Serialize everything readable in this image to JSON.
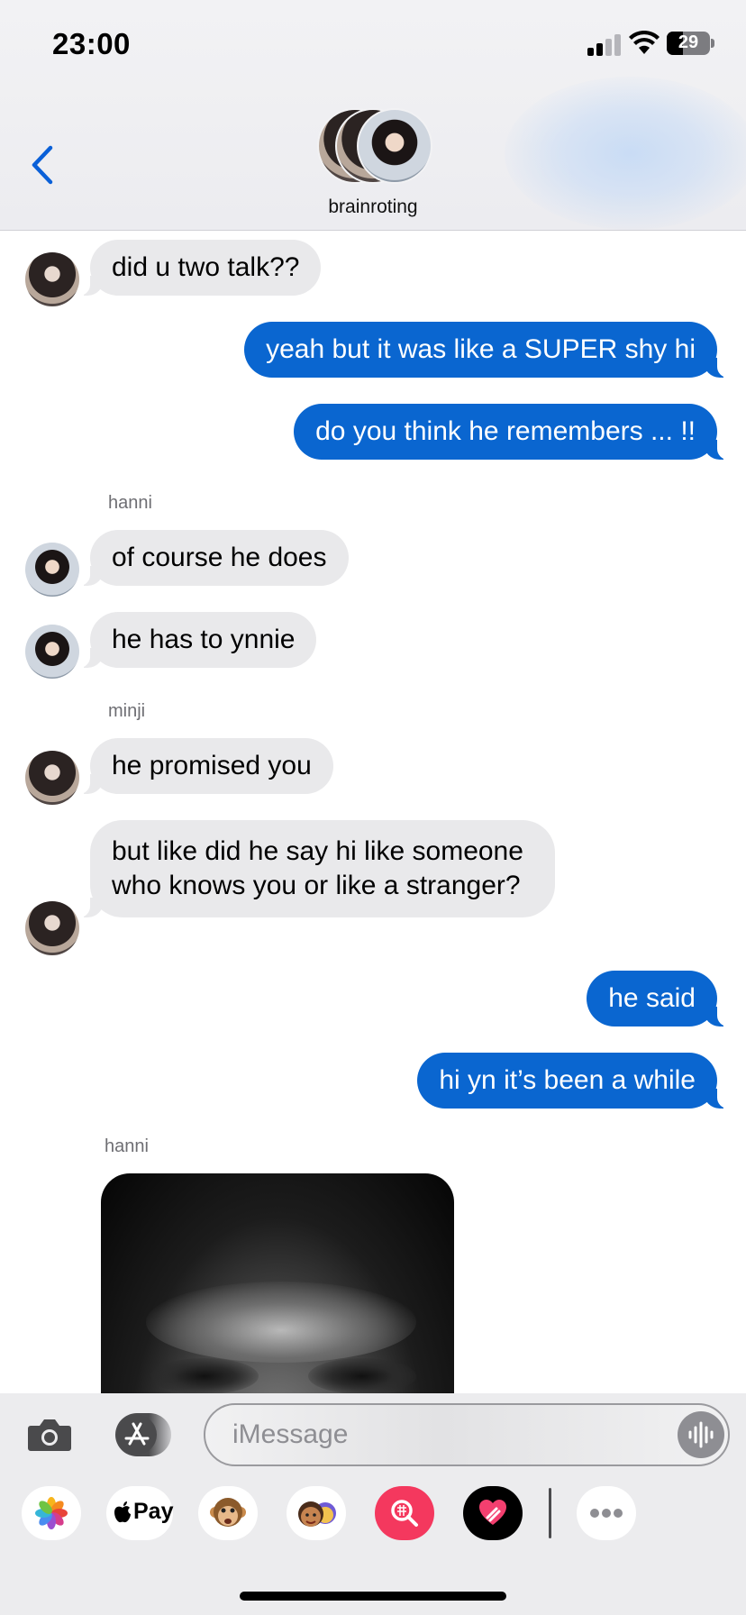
{
  "status_bar": {
    "time": "23:00",
    "battery": "29"
  },
  "header": {
    "group_name": "brainroting"
  },
  "messages": [
    {
      "direction": "incoming",
      "text": "did u two talk??"
    },
    {
      "direction": "outgoing",
      "text": "yeah but it was like a SUPER shy hi"
    },
    {
      "direction": "outgoing",
      "text": "do you think he remembers ... !!"
    },
    {
      "direction": "incoming",
      "sender": "hanni",
      "text": "of course he does"
    },
    {
      "direction": "incoming",
      "text": "he has to ynnie"
    },
    {
      "direction": "incoming",
      "sender": "minji",
      "text": "he promised you"
    },
    {
      "direction": "incoming",
      "text": "but like did he say hi like someone who knows you or like a stranger?"
    },
    {
      "direction": "outgoing",
      "text": "he said"
    },
    {
      "direction": "outgoing",
      "text": "hi yn it’s been a while"
    },
    {
      "direction": "incoming",
      "sender": "hanni",
      "type": "image"
    }
  ],
  "composer": {
    "placeholder": "iMessage"
  },
  "app_tray": {
    "items": [
      "photos-icon",
      "apple-pay-icon",
      "animoji-icon",
      "memoji-icon",
      "search-images-icon",
      "digital-touch-icon",
      "more-icon"
    ],
    "apple_pay_label": "Pay"
  },
  "colors": {
    "outgoing_bubble": "#0a66d0",
    "incoming_bubble": "#e9e9eb",
    "accent": "#0a60d8"
  }
}
